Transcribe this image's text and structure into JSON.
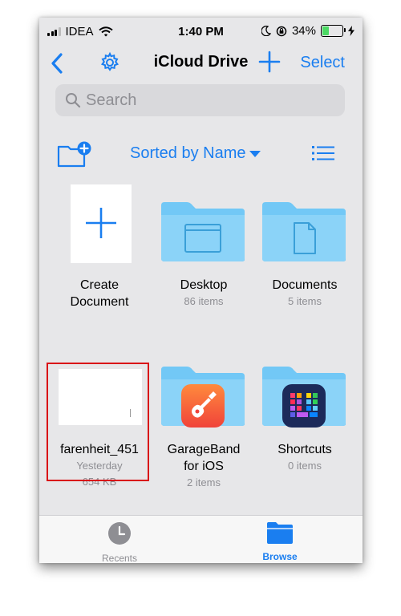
{
  "status_bar": {
    "carrier": "IDEA",
    "time": "1:40 PM",
    "battery_percent_label": "34%",
    "battery_level": 0.34,
    "battery_color": "#4cd964"
  },
  "nav": {
    "back_icon": "chevron-left-icon",
    "settings_icon": "gear-icon",
    "title": "iCloud Drive",
    "add_icon": "plus-icon",
    "select_label": "Select"
  },
  "search": {
    "placeholder": "Search",
    "value": ""
  },
  "toolbar": {
    "new_folder_icon": "new-folder-icon",
    "sort_label": "Sorted by Name",
    "list_view_icon": "list-view-icon"
  },
  "items": [
    {
      "label": "Create\nDocument",
      "meta": "",
      "kind": "create"
    },
    {
      "label": "Desktop",
      "meta": "86 items",
      "kind": "folder"
    },
    {
      "label": "Documents",
      "meta": "5 items",
      "kind": "folder"
    },
    {
      "label": "farenheit_451",
      "meta_line1": "Yesterday",
      "meta_line2": "654 KB",
      "kind": "file"
    },
    {
      "label": "GarageBand\nfor iOS",
      "meta": "2 items",
      "kind": "folder"
    },
    {
      "label": "Shortcuts",
      "meta": "0 items",
      "kind": "folder"
    }
  ],
  "tabbar": {
    "recents_label": "Recents",
    "browse_label": "Browse",
    "active_tab": "Browse"
  },
  "colors": {
    "accent": "#1a7ef0",
    "folder": "#72c8f6",
    "highlight": "#d90f17"
  }
}
